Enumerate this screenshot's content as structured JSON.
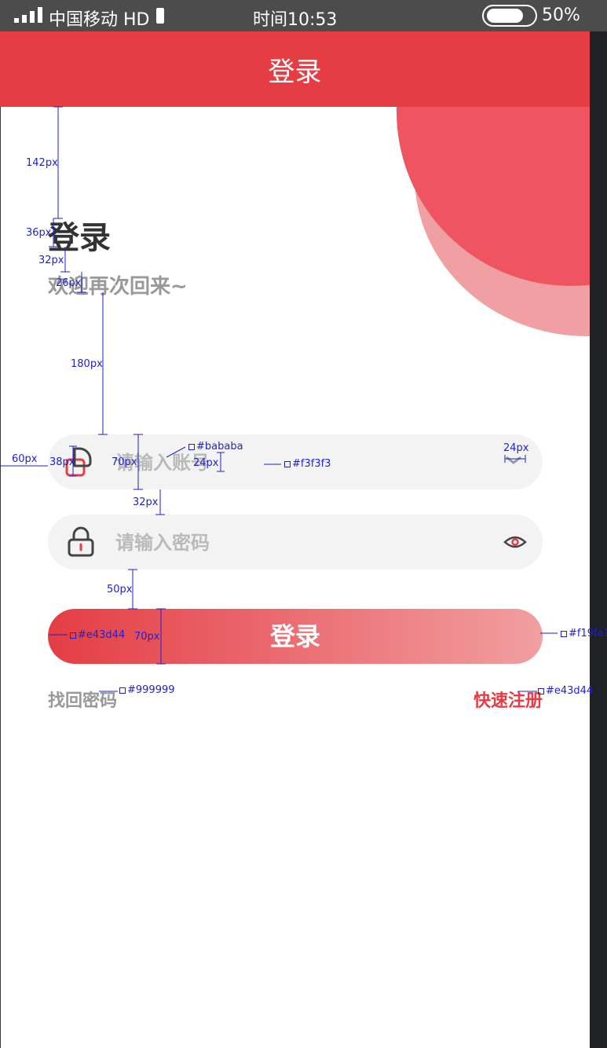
{
  "status_bar": {
    "carrier": "中国移动 HD",
    "time": "时间10:53",
    "battery": "50%"
  },
  "nav": {
    "title": "登录"
  },
  "header": {
    "title": "登录",
    "subtitle": "欢迎再次回来~"
  },
  "account": {
    "placeholder": "请输入账号"
  },
  "password": {
    "placeholder": "请输入密码"
  },
  "login_button": {
    "label": "登录"
  },
  "links": {
    "forgot": "找回密码",
    "register": "快速注册"
  },
  "icons": {
    "user": "user-icon",
    "chevron": "chevron-down-icon",
    "lock": "lock-icon",
    "eye": "eye-icon"
  },
  "colors": {
    "brand": "#e43d44",
    "gradient_end": "#f19fa1",
    "input_bg": "#f3f3f3",
    "placeholder": "#bababa",
    "muted_text": "#999999"
  },
  "annotations": {
    "d142": "142px",
    "d36": "36px",
    "d32a": "32px",
    "d26": "26px",
    "d180": "180px",
    "d60": "60px",
    "d38": "38px",
    "d70a": "70px",
    "d24a": "24px",
    "d24b": "24px",
    "d32b": "32px",
    "d50": "50px",
    "d70b": "70px",
    "c_bababa": "#bababa",
    "c_f3f3f3": "#f3f3f3",
    "c_e43d44a": "#e43d44",
    "c_f19fa1": "#f19fa1",
    "c_999999": "#999999",
    "c_e43d44b": "#e43d44"
  }
}
